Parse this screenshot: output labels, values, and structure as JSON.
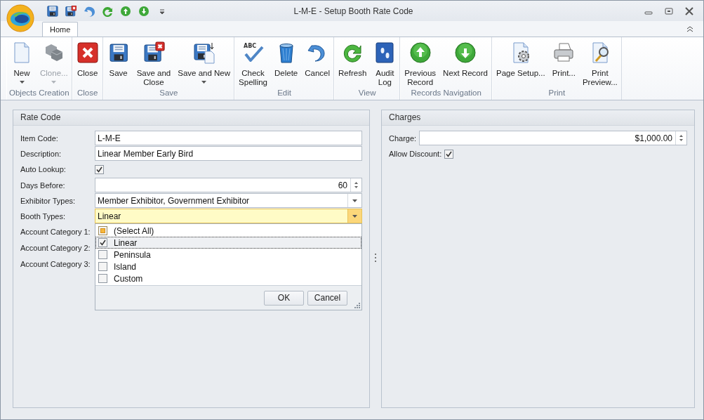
{
  "window": {
    "title": "L-M-E - Setup Booth Rate Code"
  },
  "tabs": [
    {
      "label": "Home",
      "selected": true
    }
  ],
  "ribbon": {
    "groups": [
      {
        "label": "Objects Creation",
        "buttons": [
          {
            "label": "New",
            "disabled": false,
            "dropdown": true
          },
          {
            "label": "Clone...",
            "disabled": true,
            "dropdown": true
          }
        ]
      },
      {
        "label": "Close",
        "buttons": [
          {
            "label": "Close",
            "disabled": false,
            "dropdown": false
          }
        ]
      },
      {
        "label": "Save",
        "buttons": [
          {
            "label": "Save",
            "disabled": false,
            "dropdown": false
          },
          {
            "label": "Save and Close",
            "disabled": false,
            "dropdown": false
          },
          {
            "label": "Save and New",
            "disabled": false,
            "dropdown": true
          }
        ]
      },
      {
        "label": "Edit",
        "buttons": [
          {
            "label": "Check Spelling",
            "icon_text": "ABC",
            "disabled": false,
            "dropdown": false
          },
          {
            "label": "Delete",
            "disabled": false,
            "dropdown": false
          },
          {
            "label": "Cancel",
            "disabled": false,
            "dropdown": false
          }
        ]
      },
      {
        "label": "View",
        "buttons": [
          {
            "label": "Refresh",
            "disabled": false,
            "dropdown": false
          },
          {
            "label": "Audit Log",
            "disabled": false,
            "dropdown": false
          }
        ]
      },
      {
        "label": "Records Navigation",
        "buttons": [
          {
            "label": "Previous Record",
            "disabled": false,
            "dropdown": false
          },
          {
            "label": "Next Record",
            "disabled": false,
            "dropdown": false
          }
        ]
      },
      {
        "label": "Print",
        "buttons": [
          {
            "label": "Page Setup...",
            "disabled": false,
            "dropdown": false
          },
          {
            "label": "Print...",
            "disabled": false,
            "dropdown": false
          },
          {
            "label": "Print Preview...",
            "disabled": false,
            "dropdown": false
          }
        ]
      }
    ]
  },
  "rate_code": {
    "title": "Rate Code",
    "fields": [
      {
        "kind": "text",
        "label": "Item Code:",
        "value": "L-M-E",
        "focused": false
      },
      {
        "kind": "text",
        "label": "Description:",
        "value": "Linear Member Early Bird",
        "focused": false
      },
      {
        "kind": "checkbox",
        "label": "Auto Lookup:",
        "checked": true
      },
      {
        "kind": "spin",
        "label": "Days Before:",
        "value": "60",
        "focused": false
      },
      {
        "kind": "combo",
        "label": "Exhibitor Types:",
        "value": "Member Exhibitor, Government Exhibitor",
        "focused": false
      },
      {
        "kind": "combo",
        "label": "Booth Types:",
        "value": "Linear",
        "focused": true,
        "expanded": true
      },
      {
        "kind": "covered",
        "label": "Account Category 1:"
      },
      {
        "kind": "covered",
        "label": "Account Category 2:"
      },
      {
        "kind": "covered",
        "label": "Account Category 3:"
      }
    ]
  },
  "booth_types_popup": {
    "items": [
      {
        "label": "(Select All)",
        "checked": false,
        "partial": true,
        "selected": false
      },
      {
        "label": "Linear",
        "checked": true,
        "partial": false,
        "selected": true
      },
      {
        "label": "Peninsula",
        "checked": false,
        "partial": false,
        "selected": false
      },
      {
        "label": "Island",
        "checked": false,
        "partial": false,
        "selected": false
      },
      {
        "label": "Custom",
        "checked": false,
        "partial": false,
        "selected": false
      }
    ],
    "buttons": [
      "OK",
      "Cancel"
    ]
  },
  "charges": {
    "title": "Charges",
    "fields": [
      {
        "kind": "spin",
        "label": "Charge:",
        "value": "$1,000.00",
        "focused": false
      },
      {
        "kind": "checkbox",
        "label": "Allow Discount:",
        "checked": true
      }
    ]
  }
}
